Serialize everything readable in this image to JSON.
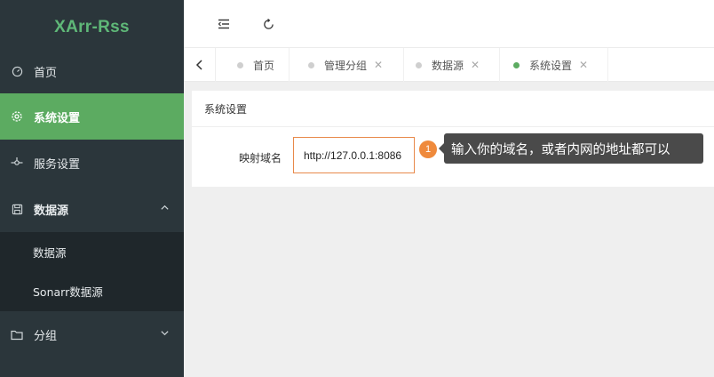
{
  "app": {
    "logo": "XArr-Rss"
  },
  "sidebar": {
    "items": [
      {
        "label": "首页",
        "icon": "dashboard-icon"
      },
      {
        "label": "系统设置",
        "icon": "gear-icon",
        "active": true
      },
      {
        "label": "服务设置",
        "icon": "service-icon"
      },
      {
        "label": "数据源",
        "icon": "save-icon",
        "expanded": true
      },
      {
        "label": "分组",
        "icon": "folder-icon"
      }
    ],
    "subitems": [
      {
        "label": "数据源"
      },
      {
        "label": "Sonarr数据源"
      }
    ]
  },
  "tabs": [
    {
      "label": "首页",
      "closable": false
    },
    {
      "label": "管理分组",
      "closable": true
    },
    {
      "label": "数据源",
      "closable": true
    },
    {
      "label": "系统设置",
      "closable": true,
      "active": true
    }
  ],
  "main": {
    "card_title": "系统设置",
    "field_label": "映射域名",
    "field_value": "http://127.0.0.1:8086",
    "step_number": "1",
    "tooltip": "输入你的域名，或者内网的地址都可以"
  },
  "colors": {
    "accent": "#5cab61",
    "sidebar_bg": "#2b363b",
    "highlight": "#e8894a",
    "tooltip_bg": "#4a4a4a"
  }
}
